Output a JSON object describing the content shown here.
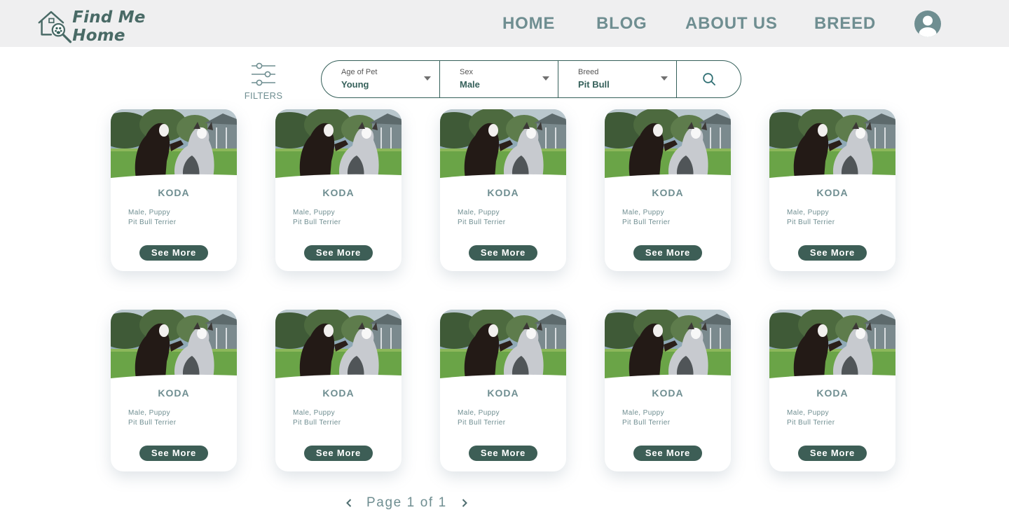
{
  "app": {
    "name": "Find Me Home"
  },
  "nav": {
    "items": [
      {
        "label": "HOME"
      },
      {
        "label": "BLOG"
      },
      {
        "label": "ABOUT US"
      },
      {
        "label": "BREED"
      }
    ],
    "avatar_icon": "user-circle-icon"
  },
  "filters": {
    "label": "FILTERS",
    "icon": "sliders-icon"
  },
  "search": {
    "fields": [
      {
        "label": "Age of Pet",
        "value": "Young"
      },
      {
        "label": "Sex",
        "value": "Male"
      },
      {
        "label": "Breed",
        "value": "Pit Bull"
      }
    ],
    "search_icon": "search-icon"
  },
  "pets": [
    {
      "name": "KODA",
      "sex_age": "Male, Puppy",
      "breed": "Pit Bull Terrier",
      "button": "See More"
    },
    {
      "name": "KODA",
      "sex_age": "Male, Puppy",
      "breed": "Pit Bull Terrier",
      "button": "See More"
    },
    {
      "name": "KODA",
      "sex_age": "Male, Puppy",
      "breed": "Pit Bull Terrier",
      "button": "See More"
    },
    {
      "name": "KODA",
      "sex_age": "Male, Puppy",
      "breed": "Pit Bull Terrier",
      "button": "See More"
    },
    {
      "name": "KODA",
      "sex_age": "Male, Puppy",
      "breed": "Pit Bull Terrier",
      "button": "See More"
    },
    {
      "name": "KODA",
      "sex_age": "Male, Puppy",
      "breed": "Pit Bull Terrier",
      "button": "See More"
    },
    {
      "name": "KODA",
      "sex_age": "Male, Puppy",
      "breed": "Pit Bull Terrier",
      "button": "See More"
    },
    {
      "name": "KODA",
      "sex_age": "Male, Puppy",
      "breed": "Pit Bull Terrier",
      "button": "See More"
    },
    {
      "name": "KODA",
      "sex_age": "Male, Puppy",
      "breed": "Pit Bull Terrier",
      "button": "See More"
    },
    {
      "name": "KODA",
      "sex_age": "Male, Puppy",
      "breed": "Pit Bull Terrier",
      "button": "See More"
    }
  ],
  "pagination": {
    "text": "Page 1 of 1",
    "current_page": 1,
    "total_pages": 1,
    "prev_icon": "chevron-left-icon",
    "next_icon": "chevron-right-icon"
  },
  "colors": {
    "navbar_bg": "#efeff0",
    "nav_text": "#6f8e91",
    "brand": "#496a66",
    "button_bg": "#3d5e56",
    "accent_border": "#35605a"
  }
}
